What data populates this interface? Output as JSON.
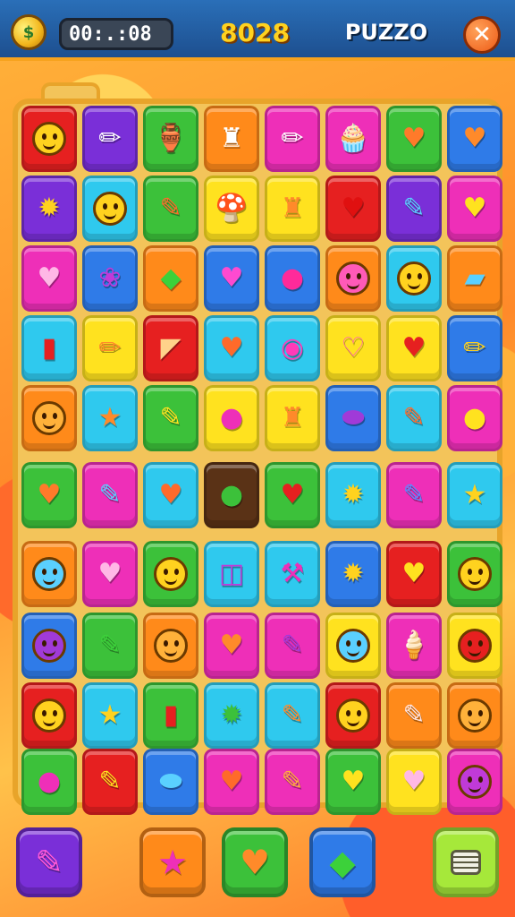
{
  "header": {
    "coin_icon": "money-coin-icon",
    "timer": "00:.:08",
    "score": "8028",
    "title": "PUZZO",
    "close_icon": "close-icon"
  },
  "board": {
    "tab_label": "",
    "rows": [
      [
        {
          "c": "#e62020",
          "i": "face",
          "fc": "#ffd21f"
        },
        {
          "c": "#7a2fd8",
          "i": "pencil",
          "g": "✏"
        },
        {
          "c": "#3cc13a",
          "i": "jar",
          "g": "🏺"
        },
        {
          "c": "#ff8a1a",
          "i": "figure",
          "g": "♜"
        },
        {
          "c": "#ee2fb8",
          "i": "pencil",
          "g": "✏"
        },
        {
          "c": "#ee2fb8",
          "i": "cupcake",
          "g": "🧁"
        },
        {
          "c": "#3cc13a",
          "i": "heart",
          "g": "♥",
          "gc": "#ff7a2a"
        },
        {
          "c": "#2f7be8",
          "i": "heart",
          "g": "♥",
          "gc": "#ff8a2a"
        }
      ],
      [
        {
          "c": "#7a2fd8",
          "i": "sun",
          "g": "✹",
          "gc": "#ffd21f"
        },
        {
          "c": "#2fc9ee",
          "i": "face",
          "fc": "#ffd21f"
        },
        {
          "c": "#3cc13a",
          "i": "crayon",
          "g": "✎",
          "gc": "#ff6a2a"
        },
        {
          "c": "#ffe21f",
          "i": "mushroom",
          "g": "🍄"
        },
        {
          "c": "#ffe21f",
          "i": "figure",
          "g": "♜",
          "gc": "#ff8a2a"
        },
        {
          "c": "#e62020",
          "i": "heart",
          "g": "♥",
          "gc": "#e01010"
        },
        {
          "c": "#7a2fd8",
          "i": "marker",
          "g": "✎",
          "gc": "#5ad0ff"
        },
        {
          "c": "#ee2fb8",
          "i": "heart",
          "g": "♥",
          "gc": "#ffe21f"
        }
      ],
      [
        {
          "c": "#ee2fb8",
          "i": "heart",
          "g": "♥",
          "gc": "#ffb8e6"
        },
        {
          "c": "#2f7be8",
          "i": "monster",
          "g": "❀",
          "gc": "#c03ad8"
        },
        {
          "c": "#ff8a1a",
          "i": "leaf",
          "g": "◆",
          "gc": "#3cd13a"
        },
        {
          "c": "#2f7be8",
          "i": "heart",
          "g": "♥",
          "gc": "#ff4ad0"
        },
        {
          "c": "#2f7be8",
          "i": "berry",
          "g": "●",
          "gc": "#ff2a9a"
        },
        {
          "c": "#ff8a1a",
          "i": "face",
          "fc": "#ff5ab8"
        },
        {
          "c": "#2fc9ee",
          "i": "face",
          "fc": "#ffd21f"
        },
        {
          "c": "#ff8a1a",
          "i": "eraser",
          "g": "▰",
          "gc": "#5ad0ff"
        }
      ],
      [
        {
          "c": "#2fc9ee",
          "i": "capsule",
          "g": "▮",
          "gc": "#e62020"
        },
        {
          "c": "#ffe21f",
          "i": "pencil",
          "g": "✏",
          "gc": "#ff8a2a"
        },
        {
          "c": "#e62020",
          "i": "cone",
          "g": "◤",
          "gc": "#ffd28a"
        },
        {
          "c": "#2fc9ee",
          "i": "heart",
          "g": "♥",
          "gc": "#ff6a2a"
        },
        {
          "c": "#2fc9ee",
          "i": "ring",
          "g": "◉",
          "gc": "#ff3ab8"
        },
        {
          "c": "#ffe21f",
          "i": "heart",
          "g": "♡",
          "gc": "#ff5ab8"
        },
        {
          "c": "#ffe21f",
          "i": "heart",
          "g": "♥",
          "gc": "#e62020"
        },
        {
          "c": "#2f7be8",
          "i": "pencil",
          "g": "✏",
          "gc": "#ffd21f"
        }
      ],
      [
        {
          "c": "#ff8a1a",
          "i": "face",
          "fc": "#ffb13a"
        },
        {
          "c": "#2fc9ee",
          "i": "star",
          "g": "★",
          "gc": "#ff8a2a"
        },
        {
          "c": "#3cc13a",
          "i": "crayon",
          "g": "✎",
          "gc": "#ffe21f"
        },
        {
          "c": "#ffe21f",
          "i": "pin",
          "g": "●",
          "gc": "#ee2fb8"
        },
        {
          "c": "#ffe21f",
          "i": "figure",
          "g": "♜",
          "gc": "#ff8a2a"
        },
        {
          "c": "#2f7be8",
          "i": "bean",
          "g": "⬬",
          "gc": "#a03ad8"
        },
        {
          "c": "#2fc9ee",
          "i": "carrot",
          "g": "✎",
          "gc": "#ff6a2a"
        },
        {
          "c": "#ee2fb8",
          "i": "lemon",
          "g": "●",
          "gc": "#ffe21f"
        }
      ],
      [
        {
          "c": "#3cc13a",
          "i": "heart",
          "g": "♥",
          "gc": "#ff7a2a"
        },
        {
          "c": "#ee2fb8",
          "i": "crayon",
          "g": "✎",
          "gc": "#5ad0ff"
        },
        {
          "c": "#2fc9ee",
          "i": "heart",
          "g": "♥",
          "gc": "#ff6a2a"
        },
        {
          "c": "#5a3216",
          "i": "apple",
          "g": "●",
          "gc": "#3cc13a"
        },
        {
          "c": "#3cc13a",
          "i": "heart",
          "g": "♥",
          "gc": "#e62020"
        },
        {
          "c": "#2fc9ee",
          "i": "sun",
          "g": "✹",
          "gc": "#ffd21f"
        },
        {
          "c": "#ee2fb8",
          "i": "pencil",
          "g": "✎",
          "gc": "#5a8aff"
        },
        {
          "c": "#2fc9ee",
          "i": "star",
          "g": "★",
          "gc": "#ffd21f"
        }
      ],
      [
        {
          "c": "#ff8a1a",
          "i": "face",
          "fc": "#5ad0ff"
        },
        {
          "c": "#ee2fb8",
          "i": "heart",
          "g": "♥",
          "gc": "#ffb8e6"
        },
        {
          "c": "#3cc13a",
          "i": "face",
          "fc": "#ffd21f"
        },
        {
          "c": "#2fc9ee",
          "i": "clip",
          "g": "◫",
          "gc": "#c03ad8"
        },
        {
          "c": "#2fc9ee",
          "i": "pick",
          "g": "⚒",
          "gc": "#ee2fb8"
        },
        {
          "c": "#2f7be8",
          "i": "sun",
          "g": "✹",
          "gc": "#ffd21f"
        },
        {
          "c": "#e62020",
          "i": "heart",
          "g": "♥",
          "gc": "#ffe21f"
        },
        {
          "c": "#3cc13a",
          "i": "face",
          "fc": "#ffd21f"
        }
      ],
      [
        {
          "c": "#2f7be8",
          "i": "face",
          "fc": "#a03ad8"
        },
        {
          "c": "#3cc13a",
          "i": "pencil",
          "g": "✎",
          "gc": "#3cd13a"
        },
        {
          "c": "#ff8a1a",
          "i": "face",
          "fc": "#ffb13a"
        },
        {
          "c": "#ee2fb8",
          "i": "heart",
          "g": "♥",
          "gc": "#ff8a2a"
        },
        {
          "c": "#ee2fb8",
          "i": "crayon",
          "g": "✎",
          "gc": "#a03ad8"
        },
        {
          "c": "#ffe21f",
          "i": "face",
          "fc": "#5ad0ff"
        },
        {
          "c": "#ee2fb8",
          "i": "icecream",
          "g": "🍦"
        },
        {
          "c": "#ffe21f",
          "i": "face",
          "fc": "#e62020"
        }
      ],
      [
        {
          "c": "#e62020",
          "i": "face",
          "fc": "#ffd21f"
        },
        {
          "c": "#2fc9ee",
          "i": "star",
          "g": "★",
          "gc": "#ffd21f"
        },
        {
          "c": "#3cc13a",
          "i": "capsule",
          "g": "▮",
          "gc": "#e62020"
        },
        {
          "c": "#2fc9ee",
          "i": "sun",
          "g": "✹",
          "gc": "#3cc13a"
        },
        {
          "c": "#2fc9ee",
          "i": "pencil",
          "g": "✎",
          "gc": "#ff8a2a"
        },
        {
          "c": "#e62020",
          "i": "face",
          "fc": "#ffd21f"
        },
        {
          "c": "#ff8a1a",
          "i": "crayon",
          "g": "✎",
          "gc": "#ffe6e6"
        },
        {
          "c": "#ff8a1a",
          "i": "face",
          "fc": "#ffb13a"
        }
      ],
      [
        {
          "c": "#3cc13a",
          "i": "berry",
          "g": "●",
          "gc": "#ee2fb8"
        },
        {
          "c": "#e62020",
          "i": "pencil",
          "g": "✎",
          "gc": "#ffe21f"
        },
        {
          "c": "#2f7be8",
          "i": "bean",
          "g": "⬬",
          "gc": "#5ad0ff"
        },
        {
          "c": "#ee2fb8",
          "i": "heart",
          "g": "♥",
          "gc": "#ff6a2a"
        },
        {
          "c": "#ee2fb8",
          "i": "pencil",
          "g": "✎",
          "gc": "#ffb13a"
        },
        {
          "c": "#3cc13a",
          "i": "heart",
          "g": "♥",
          "gc": "#ffe21f"
        },
        {
          "c": "#ffe21f",
          "i": "heart",
          "g": "♥",
          "gc": "#ffb8e6"
        },
        {
          "c": "#ee2fb8",
          "i": "face",
          "fc": "#c03ad8"
        }
      ]
    ]
  },
  "toolbar": [
    {
      "name": "crayon-button",
      "bg": "#7a2fd8",
      "icon": "crayon-icon",
      "g": "✎",
      "gc": "#ff5ad8"
    },
    {
      "name": "star-button",
      "bg": "#ff8a1a",
      "icon": "star-icon",
      "g": "★",
      "gc": "#ee2fb8"
    },
    {
      "name": "heart-button",
      "bg": "#3cc13a",
      "icon": "heart-icon",
      "g": "♥",
      "gc": "#ff8a2a"
    },
    {
      "name": "leaf-button",
      "bg": "#2f7be8",
      "icon": "leaf-icon",
      "g": "◆",
      "gc": "#3cd13a"
    },
    {
      "name": "menu-button",
      "bg": "#a6e83a",
      "icon": "menu-icon",
      "g": "",
      "gc": ""
    }
  ]
}
